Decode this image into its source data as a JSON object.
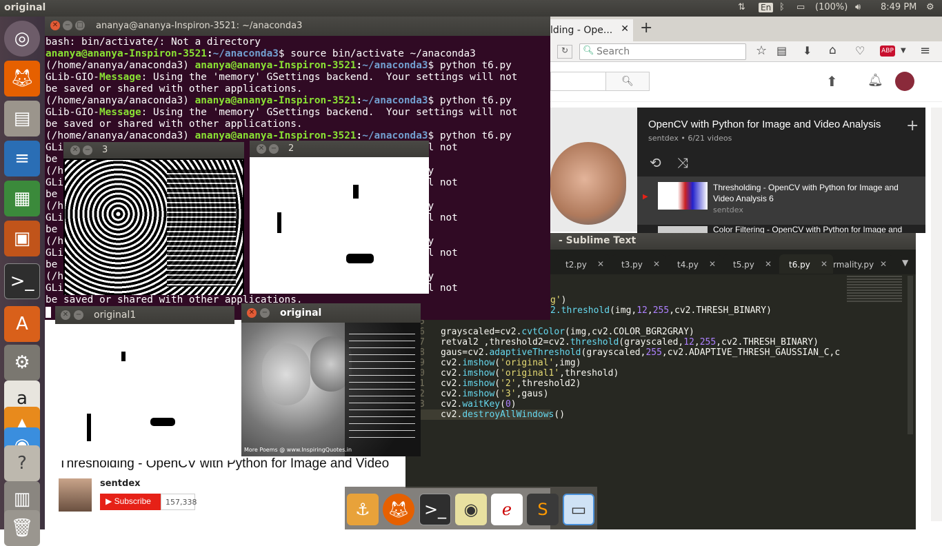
{
  "topbar": {
    "title": "original",
    "lang": "En",
    "battery": "(100%)",
    "time": "8:49 PM"
  },
  "terminal": {
    "title": "ananya@ananya-Inspiron-3521: ~/anaconda3",
    "lines": [
      [
        {
          "t": "bash: bin/activate/: Not a directory",
          "c": ""
        }
      ],
      [
        {
          "t": "ananya@ananya-Inspiron-3521",
          "c": "g"
        },
        {
          "t": ":",
          "c": "w"
        },
        {
          "t": "~/anaconda3",
          "c": "b"
        },
        {
          "t": "$ source bin/activate ~/anaconda3",
          "c": ""
        }
      ],
      [
        {
          "t": "(/home/ananya/anaconda3) ",
          "c": ""
        },
        {
          "t": "ananya@ananya-Inspiron-3521",
          "c": "g"
        },
        {
          "t": ":",
          "c": "w"
        },
        {
          "t": "~/anaconda3",
          "c": "b"
        },
        {
          "t": "$ python t6.py",
          "c": ""
        }
      ],
      [
        {
          "t": "GLib-GIO-",
          "c": ""
        },
        {
          "t": "Message",
          "c": "g"
        },
        {
          "t": ": Using the 'memory' GSettings backend.  Your settings will not",
          "c": ""
        }
      ],
      [
        {
          "t": "be saved or shared with other applications.",
          "c": ""
        }
      ],
      [
        {
          "t": "(/home/ananya/anaconda3) ",
          "c": ""
        },
        {
          "t": "ananya@ananya-Inspiron-3521",
          "c": "g"
        },
        {
          "t": ":",
          "c": "w"
        },
        {
          "t": "~/anaconda3",
          "c": "b"
        },
        {
          "t": "$ python t6.py",
          "c": ""
        }
      ],
      [
        {
          "t": "GLib-GIO-",
          "c": ""
        },
        {
          "t": "Message",
          "c": "g"
        },
        {
          "t": ": Using the 'memory' GSettings backend.  Your settings will not",
          "c": ""
        }
      ],
      [
        {
          "t": "be saved or shared with other applications.",
          "c": ""
        }
      ],
      [
        {
          "t": "(/home/ananya/anaconda3) ",
          "c": ""
        },
        {
          "t": "ananya@ananya-Inspiron-3521",
          "c": "g"
        },
        {
          "t": ":",
          "c": "w"
        },
        {
          "t": "~/anaconda3",
          "c": "b"
        },
        {
          "t": "$ python t6.py",
          "c": ""
        }
      ],
      [
        {
          "t": "GLi                                                 settings will not",
          "c": ""
        }
      ],
      [
        {
          "t": "be",
          "c": ""
        }
      ],
      [
        {
          "t": "(/h                                                $ python t6.py",
          "c": ""
        }
      ],
      [
        {
          "t": "GLi                                                 settings will not",
          "c": ""
        }
      ],
      [
        {
          "t": "be",
          "c": ""
        }
      ],
      [
        {
          "t": "(/h                                                $ python t6.py",
          "c": ""
        }
      ],
      [
        {
          "t": "GLi                                                 settings will not",
          "c": ""
        }
      ],
      [
        {
          "t": "be",
          "c": ""
        }
      ],
      [
        {
          "t": "(/h                                                $ python t6.py",
          "c": ""
        }
      ],
      [
        {
          "t": "GLi                                                 settings will not",
          "c": ""
        }
      ],
      [
        {
          "t": "be",
          "c": ""
        }
      ],
      [
        {
          "t": "(/h                                                $ python t6.py",
          "c": ""
        }
      ],
      [
        {
          "t": "GLi                                                 settings will not",
          "c": ""
        }
      ],
      [
        {
          "t": "be saved or shared with other applications.",
          "c": ""
        }
      ]
    ]
  },
  "browser": {
    "tab_title": "lding - Ope...",
    "search_placeholder": "Search",
    "playlist_title": "OpenCV with Python for Image and Video Analysis",
    "playlist_sub": "sentdex • 6/21 videos",
    "items": [
      {
        "title": "Thresholding - OpenCV with Python for Image and Video Analysis 6",
        "channel": "sentdex"
      },
      {
        "title": "Color Filtering - OpenCV with Python for Image and",
        "channel": ""
      }
    ],
    "video_title": "Thresholding - OpenCV with Python for Image and Video",
    "channel": "sentdex",
    "subscribe": "Subscribe",
    "sub_count": "157,338"
  },
  "sublime": {
    "title": "- Sublime Text",
    "tabs": [
      "t2.py",
      "t3.py",
      "t4.py",
      "t5.py",
      "t6.py",
      "rmality.py"
    ],
    "line_numbers": [
      "5",
      "6",
      "7",
      "8",
      "9",
      "0",
      "1",
      "2",
      "3",
      "4"
    ]
  },
  "windows": {
    "w3": "3",
    "w2": "2",
    "original1": "original1",
    "original": "original"
  },
  "img_text": {
    "poem_credit": "More Poems @ www.InspiringQuotes.in"
  },
  "launcher_icons": [
    "ubuntu-icon",
    "firefox-icon",
    "files-icon",
    "writer-icon",
    "calc-icon",
    "impress-icon",
    "terminal-icon",
    "software-center-icon",
    "settings-icon",
    "amazon-icon",
    "vlc-icon",
    "chrome-icon",
    "help-icon",
    "workspace-icon",
    "trash-icon"
  ],
  "dock_icons": [
    "anchor-icon",
    "firefox-icon",
    "terminal-icon",
    "audio-icon",
    "acrobat-icon",
    "sublime-icon",
    "window-icon"
  ]
}
